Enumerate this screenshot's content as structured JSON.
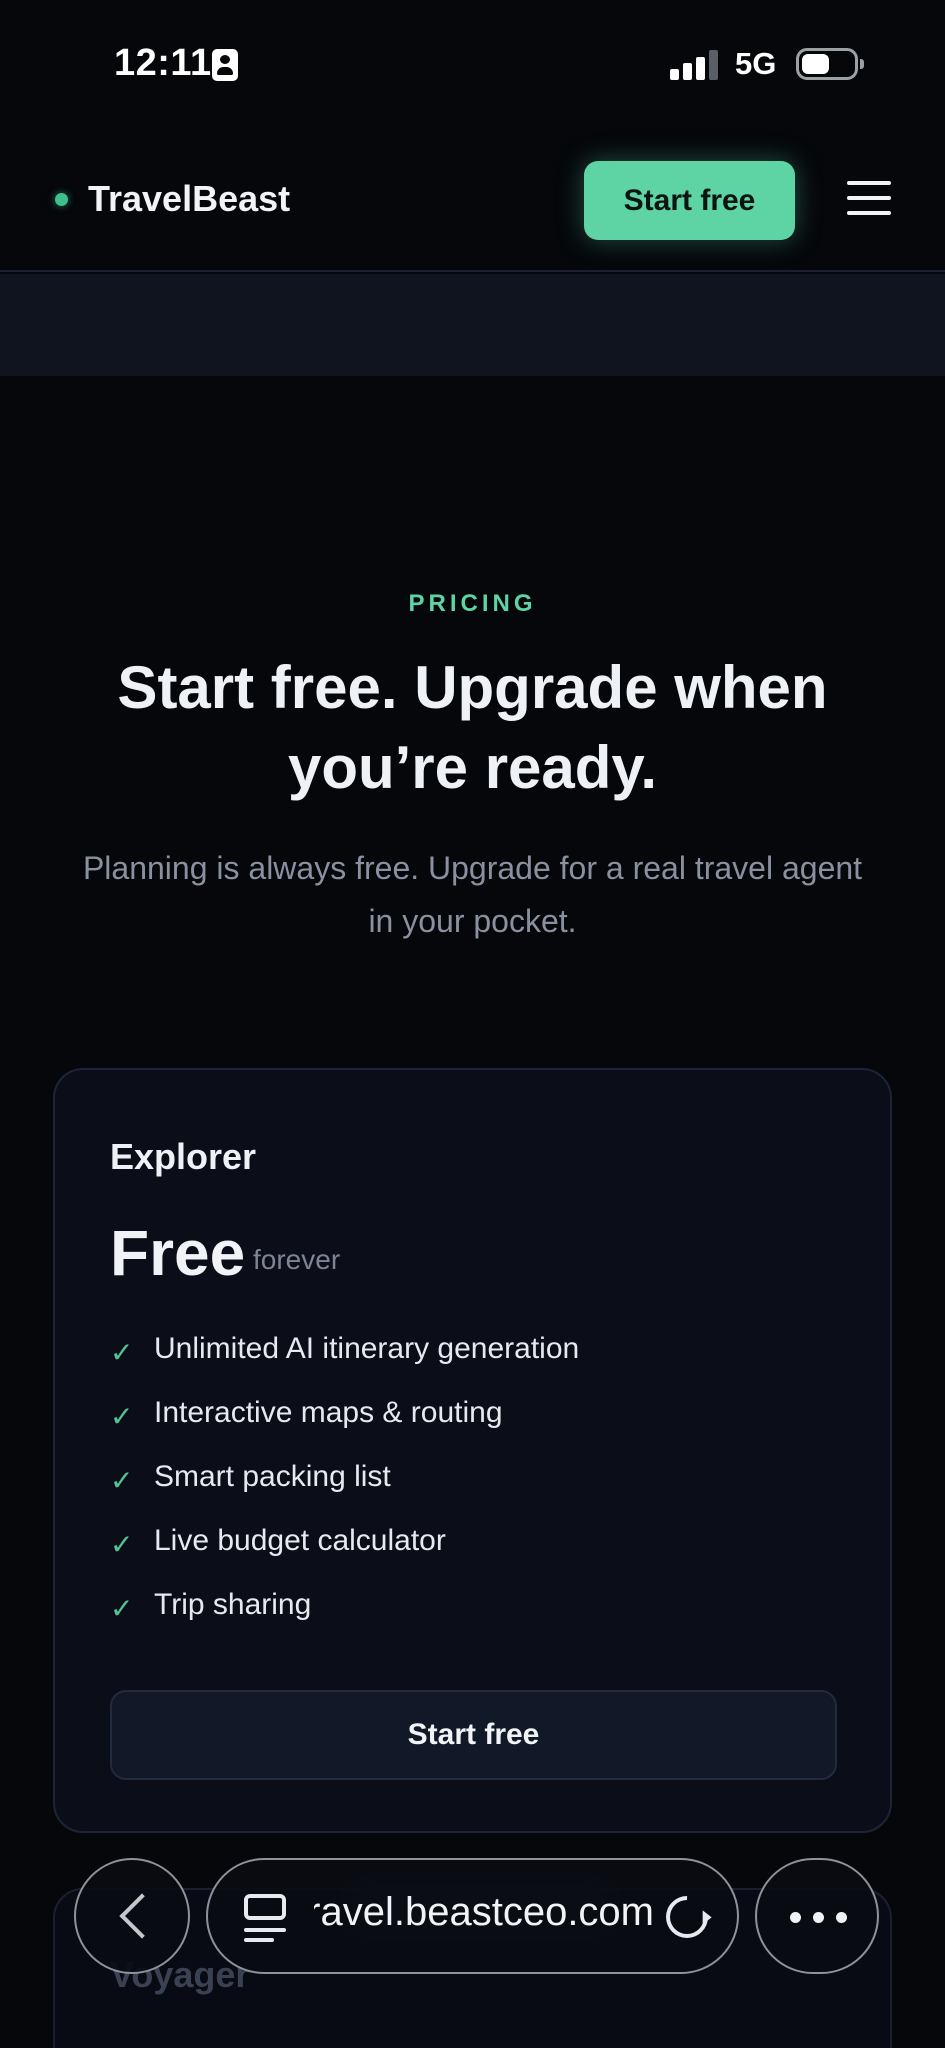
{
  "status_bar": {
    "time": "12:11",
    "network": "5G"
  },
  "nav": {
    "brand": "TravelBeast",
    "cta_label": "Start free"
  },
  "hero": {
    "eyebrow": "PRICING",
    "headline": "Start free. Upgrade when you’re ready.",
    "subhead": "Planning is always free. Upgrade for a real travel agent in your pocket."
  },
  "plans": [
    {
      "name": "Explorer",
      "price": "Free",
      "period": "forever",
      "features": [
        "Unlimited AI itinerary generation",
        "Interactive maps & routing",
        "Smart packing list",
        "Live budget calculator",
        "Trip sharing"
      ],
      "cta_label": "Start free"
    },
    {
      "name": "Voyager"
    }
  ],
  "browser": {
    "url": "travel.beastceo.com"
  },
  "colors": {
    "accent": "#5ed3a3",
    "background": "#05070b",
    "card": "#0b0e18"
  }
}
